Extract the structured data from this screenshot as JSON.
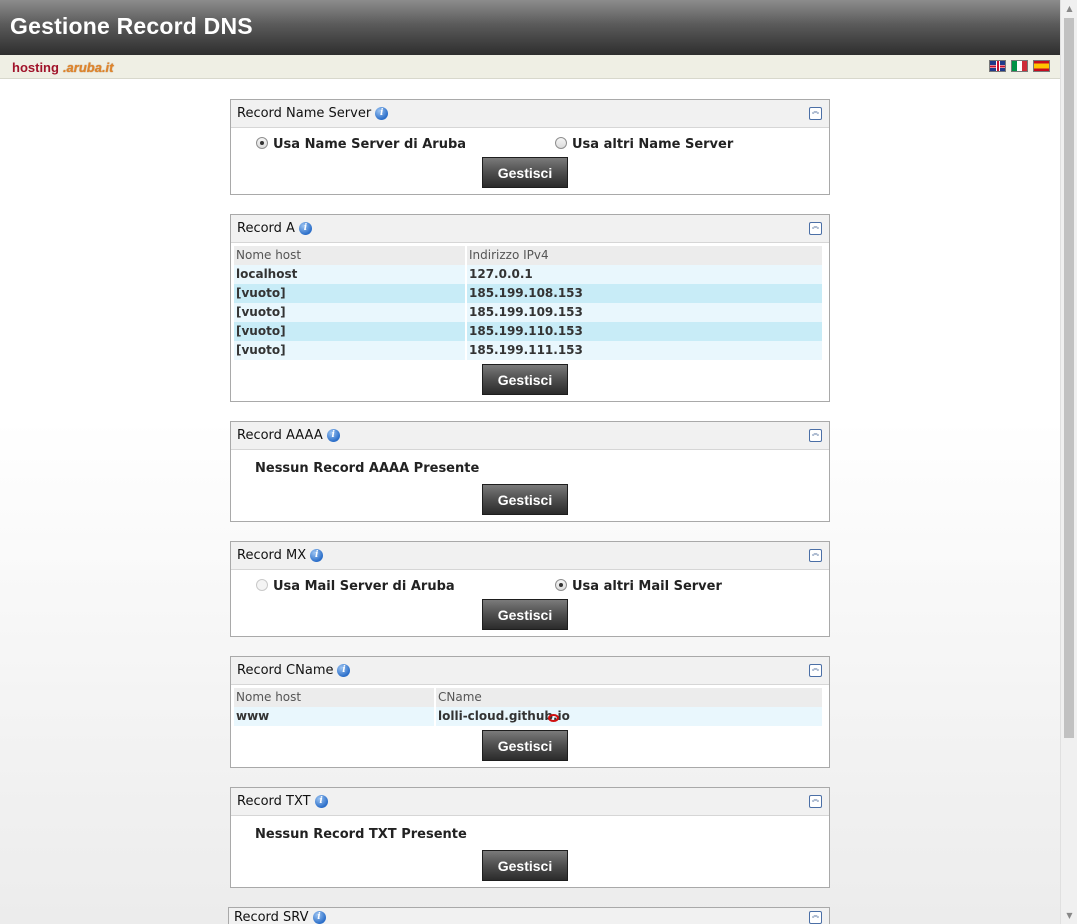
{
  "header": {
    "title": "Gestione Record DNS"
  },
  "brand": {
    "hosting": "hosting",
    "aruba": ".aruba.it"
  },
  "flags": [
    "flag-uk-icon",
    "flag-it-icon",
    "flag-es-icon"
  ],
  "panels": {
    "ns": {
      "title": "Record Name Server",
      "options": [
        {
          "label": "Usa Name Server di Aruba",
          "selected": true
        },
        {
          "label": "Usa altri Name Server",
          "selected": false
        }
      ],
      "button": "Gestisci"
    },
    "a": {
      "title": "Record A",
      "columns": [
        "Nome host",
        "Indirizzo IPv4"
      ],
      "rows": [
        [
          "localhost",
          "127.0.0.1"
        ],
        [
          "[vuoto]",
          "185.199.108.153"
        ],
        [
          "[vuoto]",
          "185.199.109.153"
        ],
        [
          "[vuoto]",
          "185.199.110.153"
        ],
        [
          "[vuoto]",
          "185.199.111.153"
        ]
      ],
      "button": "Gestisci"
    },
    "aaaa": {
      "title": "Record AAAA",
      "message": "Nessun Record AAAA Presente",
      "button": "Gestisci"
    },
    "mx": {
      "title": "Record MX",
      "options": [
        {
          "label": "Usa Mail Server di Aruba",
          "selected": false
        },
        {
          "label": "Usa altri Mail Server",
          "selected": true
        }
      ],
      "button": "Gestisci"
    },
    "cname": {
      "title": "Record CName",
      "columns": [
        "Nome host",
        "CName"
      ],
      "rows": [
        [
          "www",
          "lolli-cloud.github.io"
        ]
      ],
      "button": "Gestisci"
    },
    "txt": {
      "title": "Record TXT",
      "message": "Nessun Record TXT Presente",
      "button": "Gestisci"
    },
    "srv": {
      "title": "Record SRV"
    }
  },
  "colors": {
    "header_dark": "#2e2e2e",
    "brand_red": "#a0132a",
    "row_light": "#e9f7fd",
    "row_highlight": "#c8ecf7",
    "button_dark": "#3a3a3a"
  }
}
